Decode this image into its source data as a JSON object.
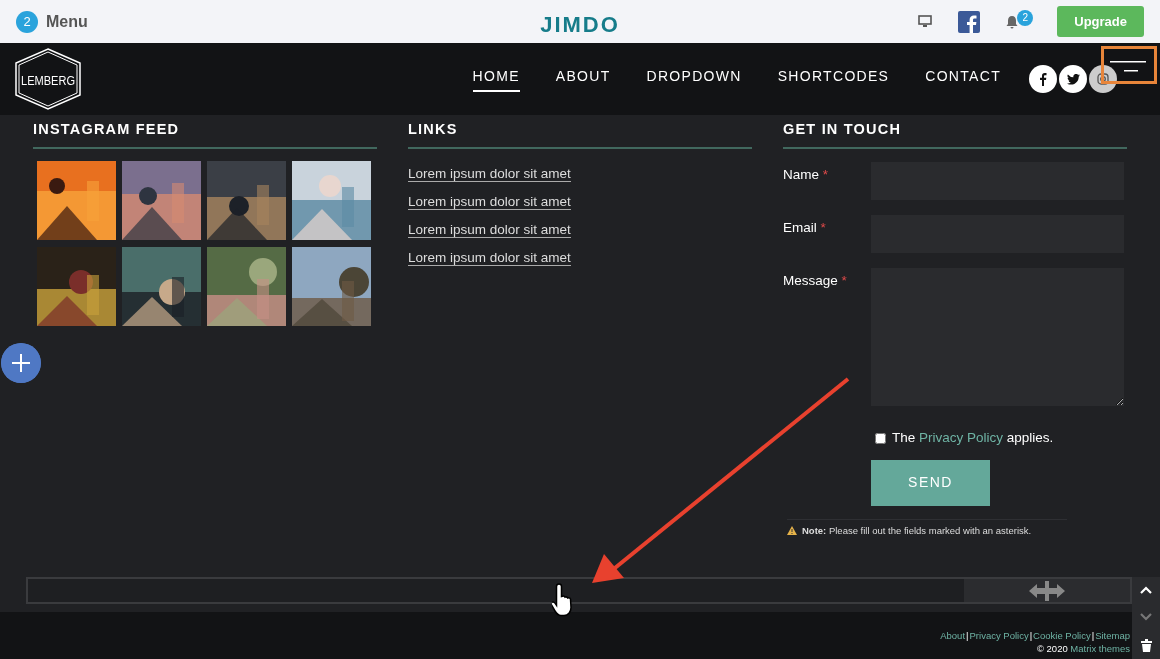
{
  "editor_bar": {
    "badge": "2",
    "menu": "Menu",
    "logo": "JIMDO",
    "notification_count": "2",
    "upgrade": "Upgrade"
  },
  "header": {
    "logo": "LEMBERG",
    "nav": [
      {
        "label": "HOME",
        "selected": true
      },
      {
        "label": "ABOUT",
        "selected": false
      },
      {
        "label": "DROPDOWN",
        "selected": false
      },
      {
        "label": "SHORTCODES",
        "selected": false
      },
      {
        "label": "CONTACT",
        "selected": false
      }
    ]
  },
  "instagram": {
    "title": "INSTAGRAM FEED"
  },
  "links": {
    "title": "LINKS",
    "items": [
      "Lorem ipsum dolor sit amet",
      "Lorem ipsum dolor sit amet",
      "Lorem ipsum dolor sit amet",
      "Lorem ipsum dolor sit amet"
    ]
  },
  "contact": {
    "title": "GET IN TOUCH",
    "fields": [
      {
        "label": "Name",
        "required": true,
        "kind": "input"
      },
      {
        "label": "Email",
        "required": true,
        "kind": "input"
      },
      {
        "label": "Message",
        "required": true,
        "kind": "textarea"
      }
    ],
    "required_mark": "*",
    "consent": {
      "prefix": "The",
      "link": "Privacy Policy",
      "suffix": "applies.",
      "checked": false
    },
    "button": "SEND",
    "note": "**Note:** Please fill out the fields marked with an asterisk."
  },
  "footer": {
    "separator": "|",
    "links": [
      "About",
      "Privacy Policy",
      "Cookie Policy",
      "Sitemap"
    ],
    "copyright": "© 2020",
    "credit": "Matrix themes"
  }
}
